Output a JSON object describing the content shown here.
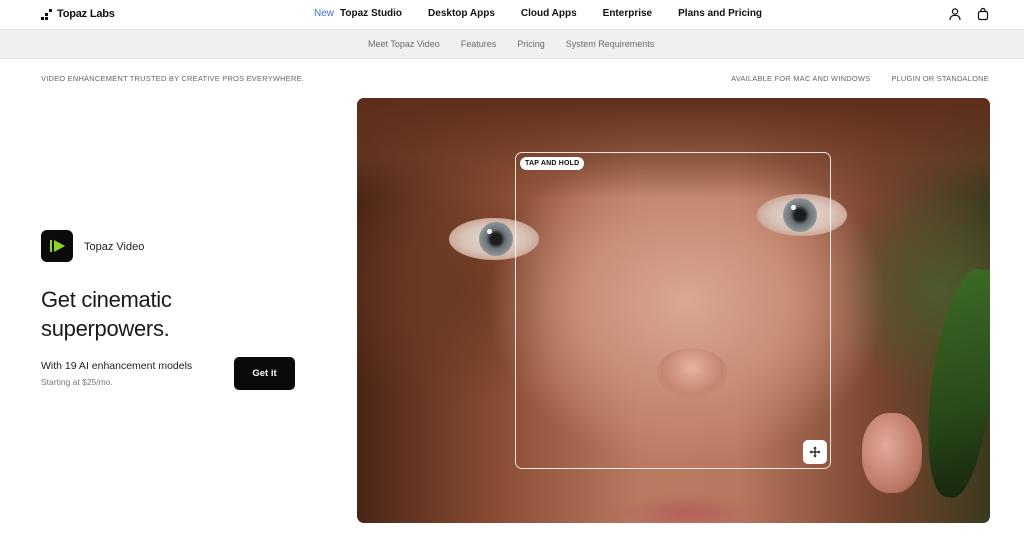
{
  "brand": {
    "name": "Topaz Labs"
  },
  "nav": {
    "new_badge": "New",
    "links": [
      "Topaz Studio",
      "Desktop Apps",
      "Cloud Apps",
      "Enterprise",
      "Plans and Pricing"
    ],
    "icons": [
      "user-icon",
      "bag-icon"
    ]
  },
  "subnav": {
    "links": [
      "Meet Topaz Video",
      "Features",
      "Pricing",
      "System Requirements"
    ]
  },
  "tagline": {
    "left": "VIDEO ENHANCEMENT TRUSTED BY CREATIVE PROS EVERYWHERE.",
    "right": [
      "AVAILABLE FOR MAC AND WINDOWS",
      "PLUGIN OR STANDALONE"
    ]
  },
  "product": {
    "name": "Topaz Video",
    "icon": "play-icon",
    "accent": "#8fd42a"
  },
  "hero": {
    "title_line1": "Get cinematic",
    "title_line2": "superpowers.",
    "subtitle": "With 19 AI enhancement models",
    "price": "Starting at $25/mo.",
    "cta": "Get it"
  },
  "video": {
    "compare_label": "TAP AND HOLD",
    "handle_icon": "move-icon"
  }
}
